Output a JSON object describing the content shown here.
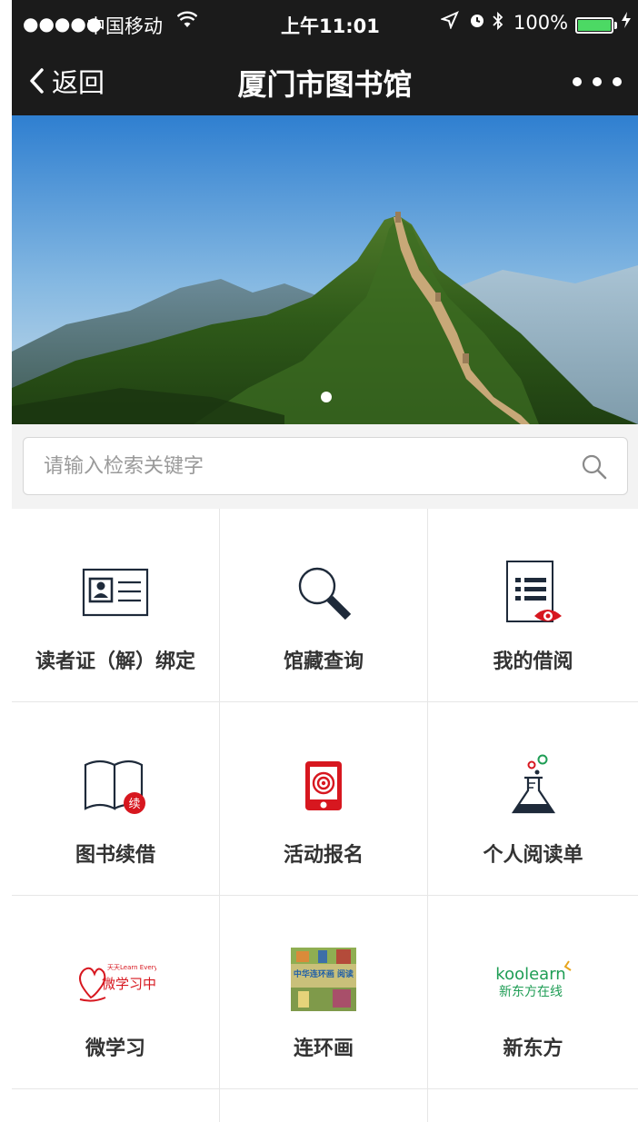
{
  "status_bar": {
    "signal": "●●●●●",
    "carrier": "中国移动",
    "time": "上午11:01",
    "battery_pct": "100%"
  },
  "nav": {
    "back_label": "返回",
    "title": "厦门市图书馆"
  },
  "banner": {
    "slide_count": 1,
    "active_slide": 1
  },
  "search": {
    "placeholder": "请输入检索关键字"
  },
  "menu": [
    {
      "label": "读者证（解）绑定",
      "icon": "id-card-icon"
    },
    {
      "label": "馆藏查询",
      "icon": "magnifier-icon"
    },
    {
      "label": "我的借阅",
      "icon": "borrow-list-icon"
    },
    {
      "label": "图书续借",
      "icon": "book-renew-icon"
    },
    {
      "label": "活动报名",
      "icon": "phone-target-icon"
    },
    {
      "label": "个人阅读单",
      "icon": "flask-icon"
    },
    {
      "label": "微学习",
      "icon": "micro-learning-logo",
      "logo_text": "天天Learn Everyday",
      "logo_main": "微学习中心"
    },
    {
      "label": "连环画",
      "icon": "comic-thumbnail",
      "logo_text": "中华连环画 阅读"
    },
    {
      "label": "新东方",
      "icon": "koolearn-logo",
      "logo_text": "koolearn",
      "logo_main": "新东方在线"
    }
  ],
  "colors": {
    "nav_bg": "#1b1b1b",
    "accent_red": "#d7171f",
    "icon_dark": "#1e2a3a",
    "koolearn_green": "#1f9d55"
  }
}
